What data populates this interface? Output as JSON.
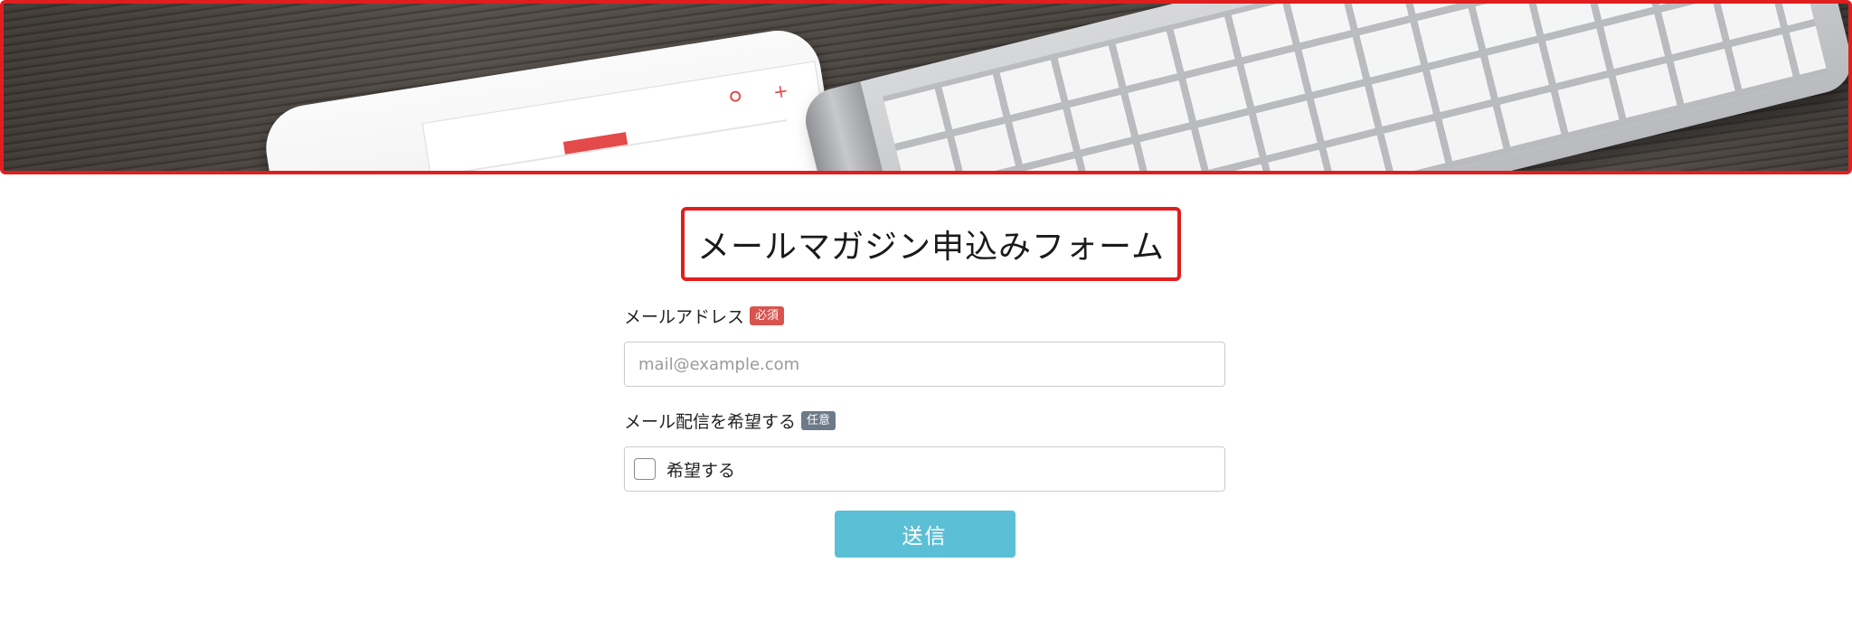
{
  "hero": {
    "description": "",
    "colors": {
      "border": "#e01e1e",
      "wood": "#4a4540"
    }
  },
  "page": {
    "title": "メールマガジン申込みフォーム"
  },
  "form": {
    "email": {
      "label": "メールアドレス",
      "badge": "必須",
      "placeholder": "mail@example.com",
      "value": ""
    },
    "subscribe": {
      "label": "メール配信を希望する",
      "badge": "任意",
      "option_label": "希望する",
      "checked": false
    },
    "submit_label": "送信"
  },
  "colors": {
    "required_badge": "#d9534f",
    "optional_badge": "#6c7a89",
    "submit_button": "#5bc0d6",
    "highlight_border": "#e01e1e"
  }
}
